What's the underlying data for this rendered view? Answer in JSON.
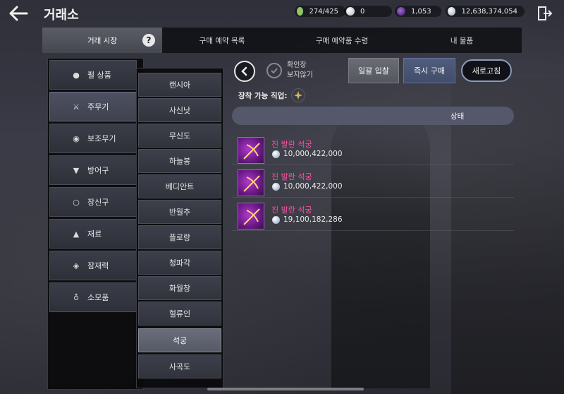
{
  "header": {
    "title": "거래소",
    "currencies": [
      {
        "icon": "energy-icon",
        "value": "274/425",
        "color": "#8fc46a"
      },
      {
        "icon": "pearl-icon",
        "value": "0",
        "color": "#d9d9d9"
      },
      {
        "icon": "crystal-icon",
        "value": "1,053",
        "color": "#7a3fb8"
      },
      {
        "icon": "silver-icon",
        "value": "12,638,374,054",
        "color": "#c8d4e2"
      }
    ]
  },
  "tabs": [
    {
      "label": "거래 시장"
    },
    {
      "label": "구매 예약 목록"
    },
    {
      "label": "구매 예약품 수령"
    },
    {
      "label": "내 물품"
    }
  ],
  "categories": [
    {
      "label": "펄 상품",
      "icon": "pearl-icon"
    },
    {
      "label": "주무기",
      "icon": "crossed-swords-icon"
    },
    {
      "label": "보조무기",
      "icon": "shield-icon"
    },
    {
      "label": "방어구",
      "icon": "armor-icon"
    },
    {
      "label": "장신구",
      "icon": "ring-icon"
    },
    {
      "label": "재료",
      "icon": "flask-icon"
    },
    {
      "label": "잠재력",
      "icon": "diamond-icon"
    },
    {
      "label": "소모품",
      "icon": "potion-icon"
    }
  ],
  "subcategories": [
    {
      "label": "랜시아"
    },
    {
      "label": "사신낫"
    },
    {
      "label": "무신도"
    },
    {
      "label": "하늘봉"
    },
    {
      "label": "베디안트"
    },
    {
      "label": "반월추"
    },
    {
      "label": "플로랑"
    },
    {
      "label": "청파각"
    },
    {
      "label": "화월창"
    },
    {
      "label": "혈류인"
    },
    {
      "label": "석궁"
    },
    {
      "label": "사곡도"
    }
  ],
  "controls": {
    "confirm_line1": "확인창",
    "confirm_line2": "보지않기",
    "bulk_buy": "일괄 입찰",
    "instant_buy": "즉시 구매",
    "refresh": "새로고침",
    "equippable_job": "장착 가능 직업:"
  },
  "list": {
    "header": "상태",
    "items": [
      {
        "name": "진 발란 석궁",
        "price": "10,000,422,000"
      },
      {
        "name": "진 발란 석궁",
        "price": "10,000,422,000"
      },
      {
        "name": "진 발란 석궁",
        "price": "19,100,182,286"
      }
    ]
  }
}
